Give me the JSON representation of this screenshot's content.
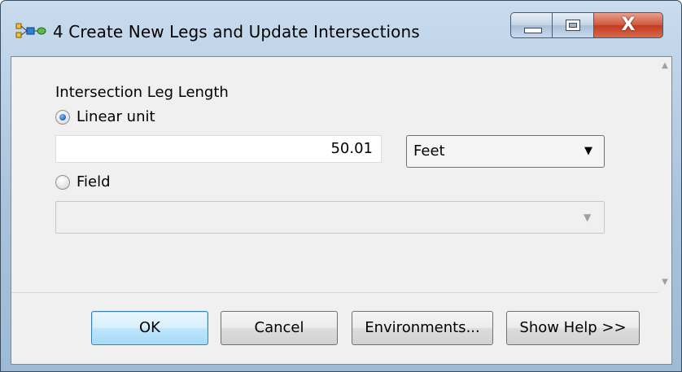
{
  "window": {
    "title": "4 Create New Legs and Update Intersections",
    "close_glyph": "X"
  },
  "form": {
    "section_label": "Intersection Leg Length",
    "linear_unit": {
      "label": "Linear unit",
      "selected": true,
      "value": "50.01",
      "unit": "Feet"
    },
    "field": {
      "label": "Field",
      "selected": false,
      "value": ""
    }
  },
  "buttons": {
    "ok": "OK",
    "cancel": "Cancel",
    "environments": "Environments...",
    "show_help": "Show Help >>"
  },
  "icons": {
    "app": "model-tool-icon",
    "minimize": "minimize-icon",
    "maximize": "maximize-icon",
    "close": "close-icon",
    "dropdown": "chevron-down-icon"
  },
  "colors": {
    "title_bar": "#b7cde3",
    "close_button": "#c94a2c",
    "default_button_border": "#3c7fb1",
    "radio_checked": "#1b63b8"
  }
}
